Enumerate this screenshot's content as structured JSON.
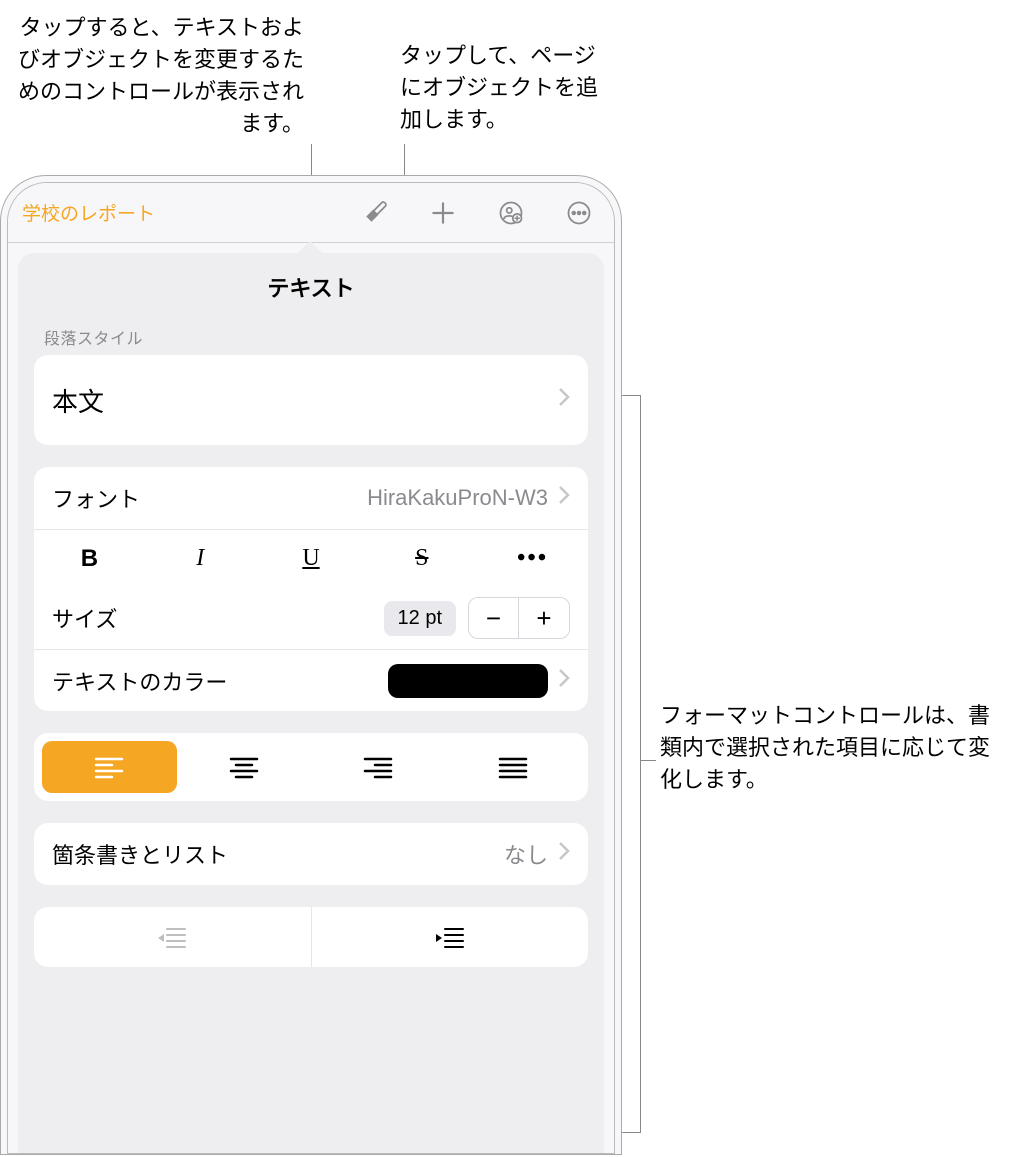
{
  "callouts": {
    "format_hint": "タップすると、テキストおよびオブジェクトを変更するためのコントロールが表示されます。",
    "insert_hint": "タップして、ページにオブジェクトを追加します。",
    "controls_hint": "フォーマットコントロールは、書類内で選択された項目に応じて変化します。"
  },
  "toolbar": {
    "doc_title": "学校のレポート"
  },
  "panel": {
    "title": "テキスト",
    "paragraph_section_label": "段落スタイル",
    "paragraph_style": "本文",
    "font_label": "フォント",
    "font_value": "HiraKakuProN-W3",
    "style_bold": "B",
    "style_italic": "I",
    "style_underline": "U",
    "style_strike": "S",
    "style_more": "•••",
    "size_label": "サイズ",
    "size_value": "12 pt",
    "color_label": "テキストのカラー",
    "color_value": "#000000",
    "bullets_label": "箇条書きとリスト",
    "bullets_value": "なし"
  }
}
